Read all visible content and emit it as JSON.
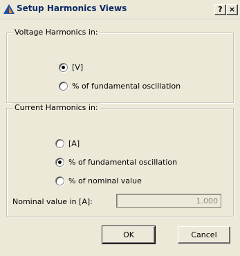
{
  "window": {
    "title": "Setup Harmonics Views",
    "help_label": "?",
    "close_label": "×"
  },
  "voltage_group": {
    "legend": "Voltage Harmonics in:",
    "options": [
      {
        "label": "[V]",
        "checked": true
      },
      {
        "label": "% of fundamental oscillation",
        "checked": false
      }
    ]
  },
  "current_group": {
    "legend": "Current Harmonics in:",
    "options": [
      {
        "label": "[A]",
        "checked": false
      },
      {
        "label": "% of fundamental oscillation",
        "checked": true
      },
      {
        "label": "% of nominal value",
        "checked": false
      }
    ],
    "nominal_label": "Nominal value in [A]:",
    "nominal_value": "1.000"
  },
  "buttons": {
    "ok_label": "OK",
    "cancel_label": "Cancel"
  },
  "colors": {
    "dialog_bg": "#ece9d8",
    "title_text": "#0b2a66",
    "icon_blue": "#1c4fa8",
    "icon_orange": "#f08a1c"
  }
}
